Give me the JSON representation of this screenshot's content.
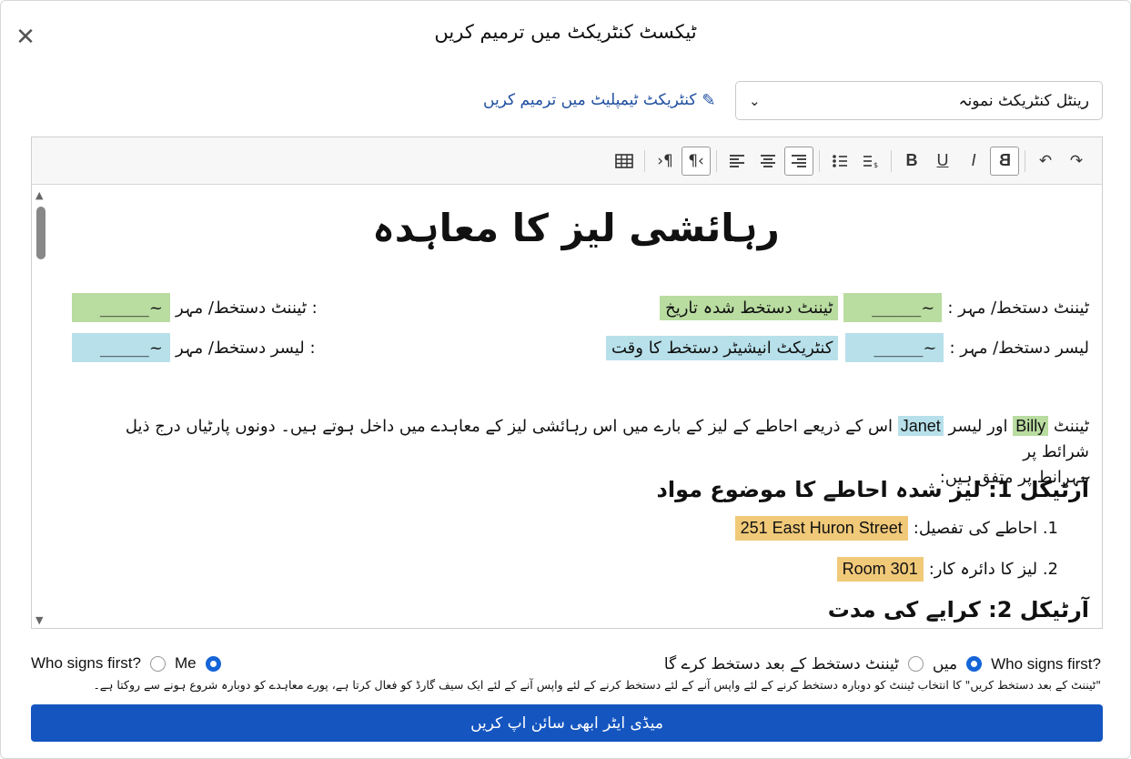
{
  "dialog": {
    "title": "ٹیکسٹ کنٹریکٹ میں ترمیم کریں",
    "close_icon": "close-icon"
  },
  "template": {
    "selected": "رینٹل کنٹریکٹ نمونہ",
    "edit_link": "کنٹریکٹ ٹیمپلیٹ میں ترمیم کریں"
  },
  "toolbar": {
    "icons": [
      "redo-icon",
      "undo-icon",
      "strikethrough-icon",
      "italic-icon",
      "underline-icon",
      "bold-icon",
      "numbered-list-icon",
      "bullet-list-icon",
      "align-right-icon",
      "align-center-icon",
      "align-left-icon",
      "rtl-paragraph-icon",
      "ltr-paragraph-icon",
      "table-icon"
    ],
    "bold": "B",
    "underline": "U",
    "italic": "I",
    "strike": "B"
  },
  "document": {
    "title": "رہائشی لیز کا معاہدہ",
    "tenant_sig_label": "ٹیننٹ دستخط/ مہر :",
    "tenant_sig_date": "ٹیننٹ دستخط شدہ تاریخ",
    "tenant_sig_left": ": ٹیننٹ دستخط/ مہر",
    "lessor_sig_label": "لیسر دستخط/ مہر :",
    "lessor_sig_time": "کنٹریکٹ انیشیٹر دستخط کا وقت",
    "lessor_sig_left": ": لیسر دستخط/ مہر",
    "sig_line": "~______",
    "intro_p1": "ٹیننٹ",
    "tenant_name": "Billy",
    "intro_p2": "اور لیسر",
    "lessor_name": "Janet",
    "intro_p3": "اس کے ذریعے احاطے کے لیز کے بارے میں اس رہائشی لیز کے معاہدے میں داخل ہوتے ہیں۔ دونوں پارٹیاں درج ذیل شرائط پر",
    "intro_p4": "مہرانط پر متفق ہیں:",
    "article1": "آرٹیکل 1: لیز شدہ احاطے کا موضوع مواد",
    "item1_label": "1. احاطے کی تفصیل:",
    "item1_value": "251 East Huron Street",
    "item2_label": "2. لیز کا دائرہ کار:",
    "item2_value": "Room 301",
    "article2": "آرٹیکل 2: کرایے کی مدت"
  },
  "signing": {
    "left_label": "Who signs first?",
    "left_option": "Me",
    "right_label": "Who signs first?",
    "right_option_me": "میں",
    "right_option_tenant": "ٹیننٹ دستخط کے بعد دستخط کرے گا",
    "note": "\"ٹیننٹ کے بعد دستخط کریں\" کا انتخاب ٹیننٹ کو دوبارہ دستخط کرنے کے لئے واپس آنے کے لئے دستخط کرنے کے لئے واپس آنے کے لئے ایک سیف گارڈ کو فعال کرتا ہے، پورے معاہدے کو دوبارہ شروع ہونے سے روکتا ہے۔",
    "submit": "میڈی ایٹر ابھی سائن اپ کریں"
  },
  "colors": {
    "primary": "#1455c0",
    "highlight_green": "#b9dca0",
    "highlight_blue": "#b7e0ea",
    "highlight_orange": "#f0c979"
  }
}
